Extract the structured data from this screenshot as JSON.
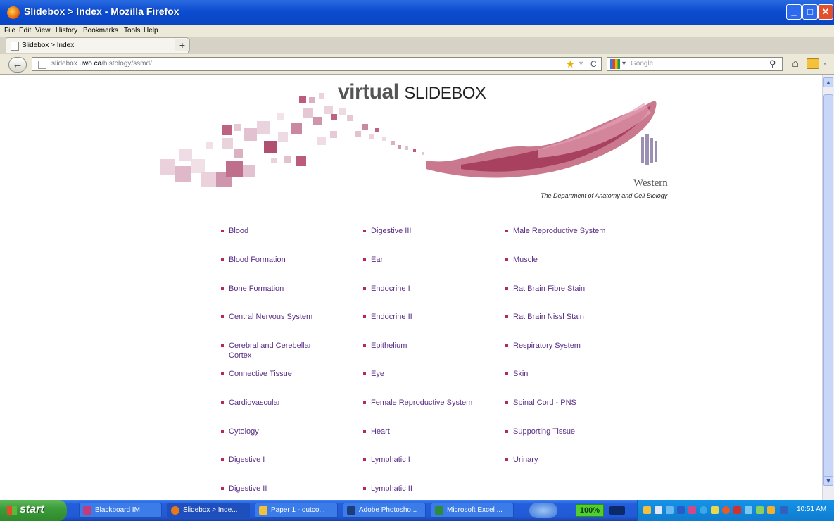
{
  "window": {
    "title": "Slidebox > Index - Mozilla Firefox"
  },
  "menu": [
    "File",
    "Edit",
    "View",
    "History",
    "Bookmarks",
    "Tools",
    "Help"
  ],
  "tab": {
    "label": "Slidebox > Index",
    "new_tab": "+"
  },
  "nav": {
    "url_host": "slidebox.",
    "url_domain": "uwo.ca",
    "url_path": "/histology/ssmd/",
    "search_placeholder": "Google"
  },
  "page": {
    "logo_bold": "virtual",
    "logo_rest": "SLIDEBOX",
    "western": "Western",
    "department": "The Department of Anatomy and Cell Biology",
    "columns": [
      [
        "Blood",
        "Blood Formation",
        "Bone Formation",
        "Central Nervous System",
        "Cerebral and Cerebellar Cortex",
        "Connective Tissue",
        "Cardiovascular",
        "Cytology",
        "Digestive I",
        "Digestive II"
      ],
      [
        "Digestive III",
        "Ear",
        "Endocrine I",
        "Endocrine II",
        "Epithelium",
        "Eye",
        "Female Reproductive System",
        "Heart",
        "Lymphatic I",
        "Lymphatic II"
      ],
      [
        "Male Reproductive System",
        "Muscle",
        "Rat Brain Fibre Stain",
        "Rat Brain Nissl Stain",
        "Respiratory System",
        "Skin",
        "Spinal Cord - PNS",
        "Supporting Tissue",
        "Urinary"
      ]
    ],
    "link_color": "#5a2d86",
    "bullet_color": "#b22a57"
  },
  "taskbar": {
    "start": "start",
    "items": [
      "Blackboard IM",
      "Slidebox > Inde...",
      "Paper 1 - outco...",
      "Adobe Photosho...",
      "Microsoft Excel ..."
    ],
    "zoom": "100%",
    "clock": "10:51 AM"
  }
}
